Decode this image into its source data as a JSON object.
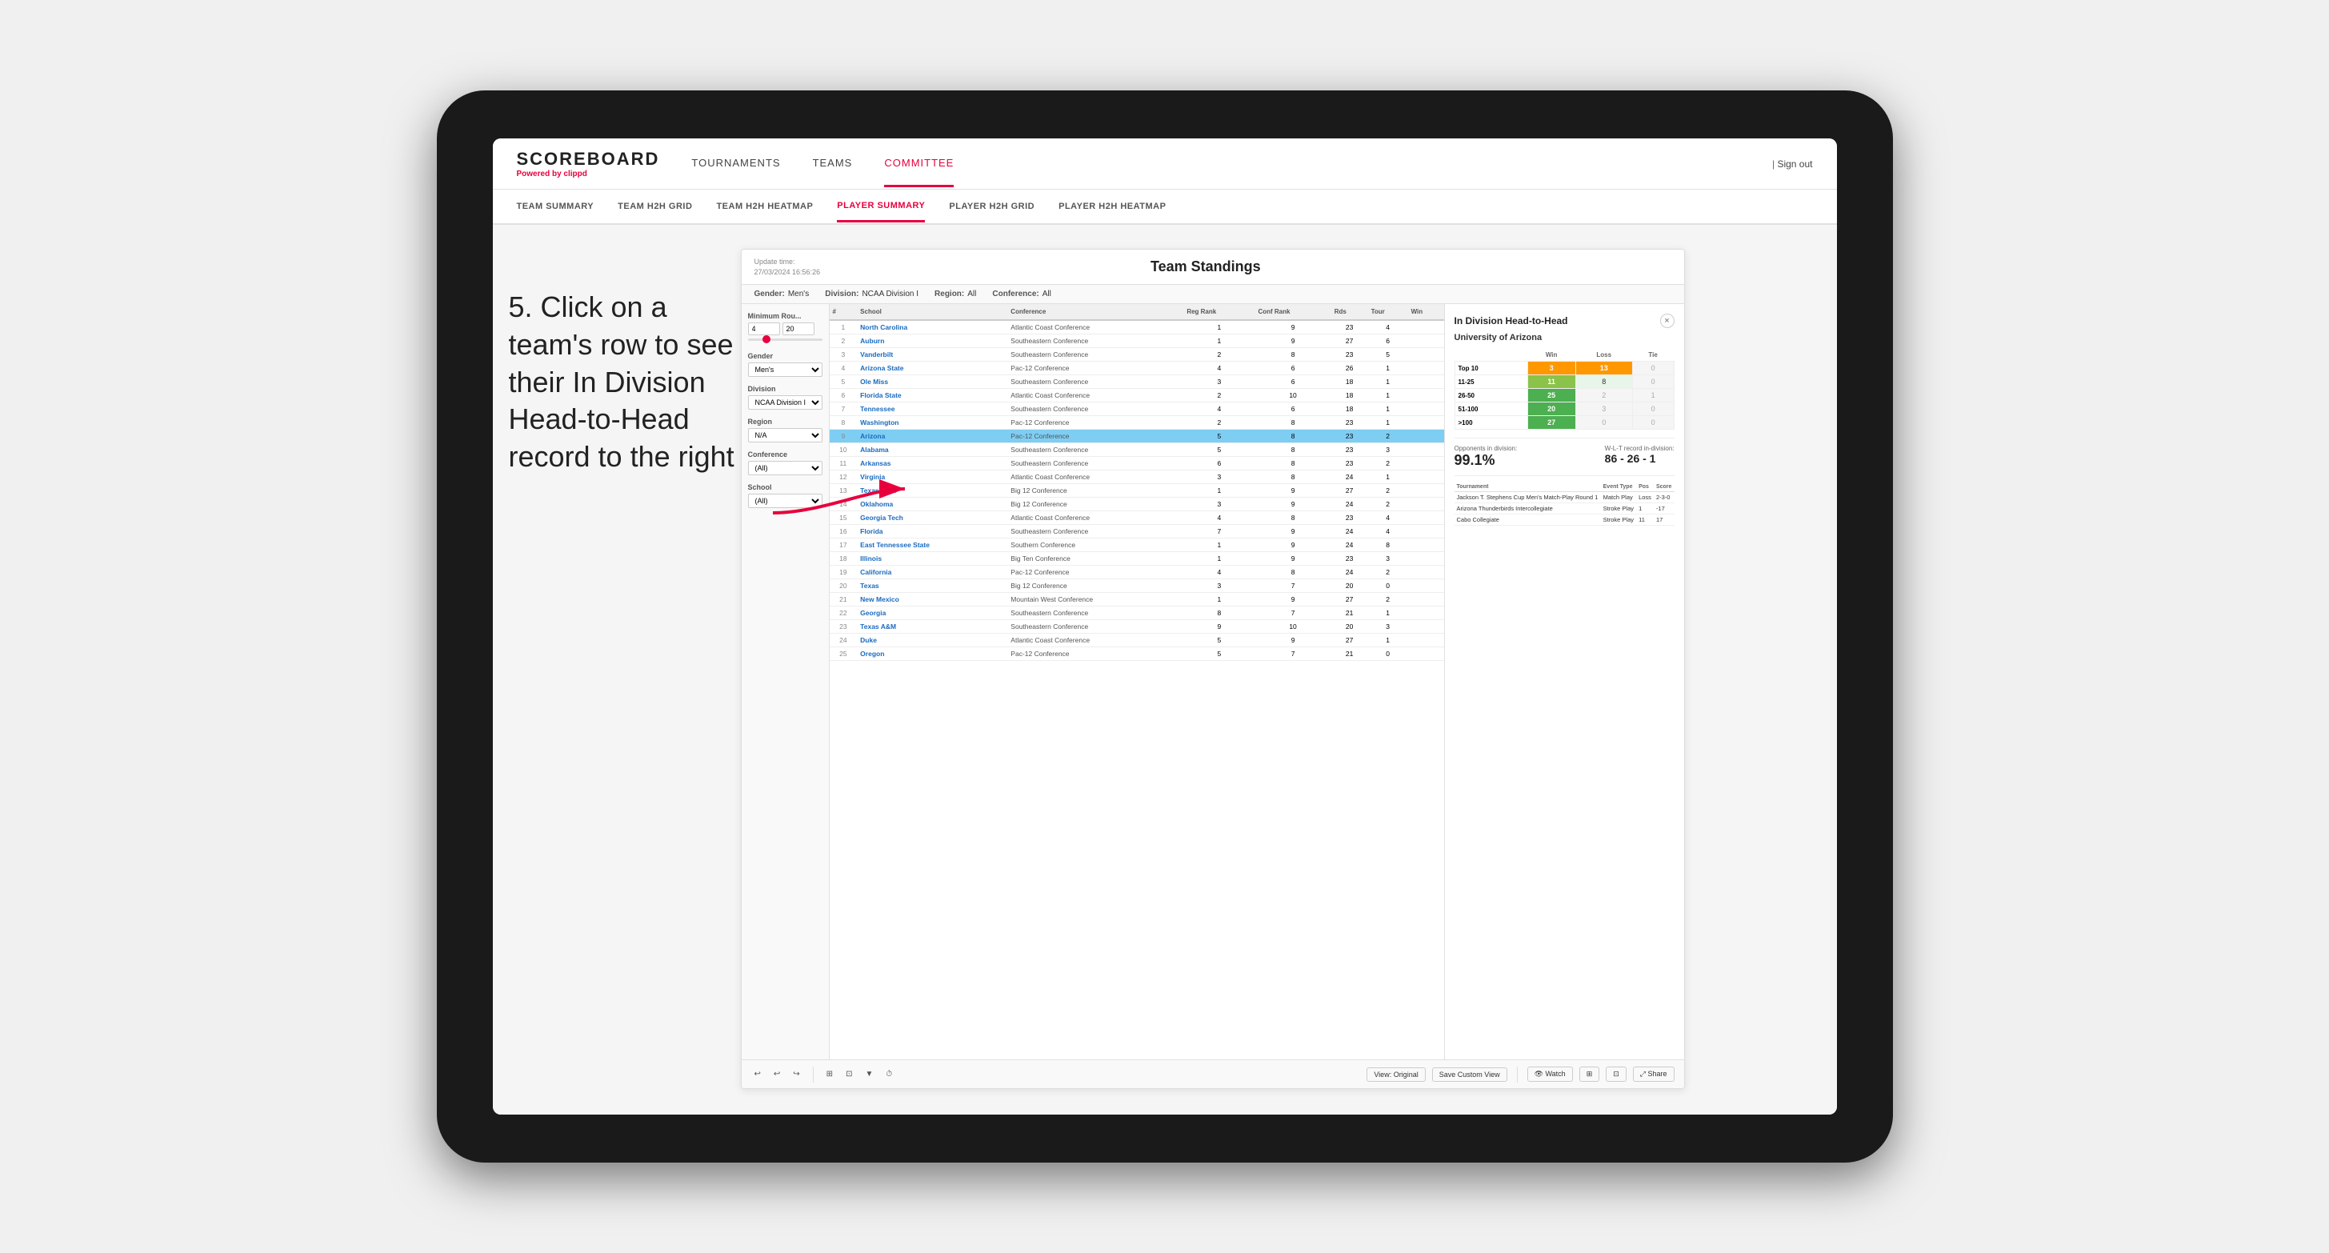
{
  "app": {
    "logo": "SCOREBOARD",
    "logo_sub": "Powered by",
    "logo_brand": "clippd",
    "nav_items": [
      "TOURNAMENTS",
      "TEAMS",
      "COMMITTEE"
    ],
    "active_nav": "COMMITTEE",
    "sign_out": "Sign out"
  },
  "sub_nav": {
    "items": [
      "TEAM SUMMARY",
      "TEAM H2H GRID",
      "TEAM H2H HEATMAP",
      "PLAYER SUMMARY",
      "PLAYER H2H GRID",
      "PLAYER H2H HEATMAP"
    ],
    "active": "PLAYER SUMMARY"
  },
  "panel": {
    "update_time_label": "Update time:",
    "update_time": "27/03/2024 16:56:26",
    "title": "Team Standings",
    "filters": {
      "gender_label": "Gender:",
      "gender": "Men's",
      "division_label": "Division:",
      "division": "NCAA Division I",
      "region_label": "Region:",
      "region": "All",
      "conference_label": "Conference:",
      "conference": "All"
    }
  },
  "sidebar": {
    "min_rounds_label": "Minimum Rou...",
    "min_val": "4",
    "max_val": "20",
    "gender_label": "Gender",
    "gender_value": "Men's",
    "division_label": "Division",
    "division_value": "NCAA Division I",
    "region_label": "Region",
    "region_value": "N/A",
    "conference_label": "Conference",
    "conference_value": "(All)",
    "school_label": "School",
    "school_value": "(All)"
  },
  "table": {
    "headers": [
      "#",
      "School",
      "Conference",
      "Reg Rank",
      "Conf Rank",
      "Rds",
      "Tour",
      "Win"
    ],
    "rows": [
      {
        "rank": 1,
        "school": "North Carolina",
        "conf": "Atlantic Coast Conference",
        "reg_rank": 1,
        "conf_rank": 9,
        "rds": 23,
        "tour": 4,
        "win": ""
      },
      {
        "rank": 2,
        "school": "Auburn",
        "conf": "Southeastern Conference",
        "reg_rank": 1,
        "conf_rank": 9,
        "rds": 27,
        "tour": 6,
        "win": ""
      },
      {
        "rank": 3,
        "school": "Vanderbilt",
        "conf": "Southeastern Conference",
        "reg_rank": 2,
        "conf_rank": 8,
        "rds": 23,
        "tour": 5,
        "win": ""
      },
      {
        "rank": 4,
        "school": "Arizona State",
        "conf": "Pac-12 Conference",
        "reg_rank": 4,
        "conf_rank": 6,
        "rds": 26,
        "tour": 1,
        "win": ""
      },
      {
        "rank": 5,
        "school": "Ole Miss",
        "conf": "Southeastern Conference",
        "reg_rank": 3,
        "conf_rank": 6,
        "rds": 18,
        "tour": 1,
        "win": ""
      },
      {
        "rank": 6,
        "school": "Florida State",
        "conf": "Atlantic Coast Conference",
        "reg_rank": 2,
        "conf_rank": 10,
        "rds": 18,
        "tour": 1,
        "win": ""
      },
      {
        "rank": 7,
        "school": "Tennessee",
        "conf": "Southeastern Conference",
        "reg_rank": 4,
        "conf_rank": 6,
        "rds": 18,
        "tour": 1,
        "win": ""
      },
      {
        "rank": 8,
        "school": "Washington",
        "conf": "Pac-12 Conference",
        "reg_rank": 2,
        "conf_rank": 8,
        "rds": 23,
        "tour": 1,
        "win": ""
      },
      {
        "rank": 9,
        "school": "Arizona",
        "conf": "Pac-12 Conference",
        "reg_rank": 5,
        "conf_rank": 8,
        "rds": 23,
        "tour": 2,
        "win": "",
        "highlight": true
      },
      {
        "rank": 10,
        "school": "Alabama",
        "conf": "Southeastern Conference",
        "reg_rank": 5,
        "conf_rank": 8,
        "rds": 23,
        "tour": 3,
        "win": ""
      },
      {
        "rank": 11,
        "school": "Arkansas",
        "conf": "Southeastern Conference",
        "reg_rank": 6,
        "conf_rank": 8,
        "rds": 23,
        "tour": 2,
        "win": ""
      },
      {
        "rank": 12,
        "school": "Virginia",
        "conf": "Atlantic Coast Conference",
        "reg_rank": 3,
        "conf_rank": 8,
        "rds": 24,
        "tour": 1,
        "win": ""
      },
      {
        "rank": 13,
        "school": "Texas Tech",
        "conf": "Big 12 Conference",
        "reg_rank": 1,
        "conf_rank": 9,
        "rds": 27,
        "tour": 2,
        "win": ""
      },
      {
        "rank": 14,
        "school": "Oklahoma",
        "conf": "Big 12 Conference",
        "reg_rank": 3,
        "conf_rank": 9,
        "rds": 24,
        "tour": 2,
        "win": ""
      },
      {
        "rank": 15,
        "school": "Georgia Tech",
        "conf": "Atlantic Coast Conference",
        "reg_rank": 4,
        "conf_rank": 8,
        "rds": 23,
        "tour": 4,
        "win": ""
      },
      {
        "rank": 16,
        "school": "Florida",
        "conf": "Southeastern Conference",
        "reg_rank": 7,
        "conf_rank": 9,
        "rds": 24,
        "tour": 4,
        "win": ""
      },
      {
        "rank": 17,
        "school": "East Tennessee State",
        "conf": "Southern Conference",
        "reg_rank": 1,
        "conf_rank": 9,
        "rds": 24,
        "tour": 8,
        "win": ""
      },
      {
        "rank": 18,
        "school": "Illinois",
        "conf": "Big Ten Conference",
        "reg_rank": 1,
        "conf_rank": 9,
        "rds": 23,
        "tour": 3,
        "win": ""
      },
      {
        "rank": 19,
        "school": "California",
        "conf": "Pac-12 Conference",
        "reg_rank": 4,
        "conf_rank": 8,
        "rds": 24,
        "tour": 2,
        "win": ""
      },
      {
        "rank": 20,
        "school": "Texas",
        "conf": "Big 12 Conference",
        "reg_rank": 3,
        "conf_rank": 7,
        "rds": 20,
        "tour": 0,
        "win": ""
      },
      {
        "rank": 21,
        "school": "New Mexico",
        "conf": "Mountain West Conference",
        "reg_rank": 1,
        "conf_rank": 9,
        "rds": 27,
        "tour": 2,
        "win": ""
      },
      {
        "rank": 22,
        "school": "Georgia",
        "conf": "Southeastern Conference",
        "reg_rank": 8,
        "conf_rank": 7,
        "rds": 21,
        "tour": 1,
        "win": ""
      },
      {
        "rank": 23,
        "school": "Texas A&M",
        "conf": "Southeastern Conference",
        "reg_rank": 9,
        "conf_rank": 10,
        "rds": 20,
        "tour": 3,
        "win": ""
      },
      {
        "rank": 24,
        "school": "Duke",
        "conf": "Atlantic Coast Conference",
        "reg_rank": 5,
        "conf_rank": 9,
        "rds": 27,
        "tour": 1,
        "win": ""
      },
      {
        "rank": 25,
        "school": "Oregon",
        "conf": "Pac-12 Conference",
        "reg_rank": 5,
        "conf_rank": 7,
        "rds": 21,
        "tour": 0,
        "win": ""
      }
    ]
  },
  "h2h": {
    "title": "In Division Head-to-Head",
    "team": "University of Arizona",
    "close_label": "×",
    "headers": [
      "",
      "Win",
      "Loss",
      "Tie"
    ],
    "rows": [
      {
        "label": "Top 10",
        "win": 3,
        "loss": 13,
        "tie": 0,
        "win_class": "cell-orange",
        "loss_class": "cell-orange"
      },
      {
        "label": "11-25",
        "win": 11,
        "loss": 8,
        "tie": 0,
        "win_class": "cell-light-green",
        "loss_class": "cell-light"
      },
      {
        "label": "26-50",
        "win": 25,
        "loss": 2,
        "tie": 1,
        "win_class": "cell-green",
        "loss_class": "cell-zero"
      },
      {
        "label": "51-100",
        "win": 20,
        "loss": 3,
        "tie": 0,
        "win_class": "cell-green",
        "loss_class": "cell-zero"
      },
      {
        "label": ">100",
        "win": 27,
        "loss": 0,
        "tie": 0,
        "win_class": "cell-green",
        "loss_class": "cell-zero"
      }
    ],
    "opponents_label": "Opponents in division:",
    "opponents_pct": "99.1%",
    "wlt_label": "W-L-T record in-division:",
    "wlt_record": "86 - 26 - 1",
    "tournament_label": "Tournament",
    "event_type_label": "Event Type",
    "pos_label": "Pos",
    "score_label": "Score",
    "tournaments": [
      {
        "name": "Jackson T. Stephens Cup Men's Match-Play Round 1",
        "type": "Match Play",
        "result": "Loss",
        "pos": "2-3-0",
        "score": ""
      },
      {
        "name": "Arizona Thunderbirds Intercollegiate",
        "type": "Stroke Play",
        "pos": "1",
        "score": "-17"
      },
      {
        "name": "Cabo Collegiate",
        "type": "Stroke Play",
        "pos": "11",
        "score": "17"
      }
    ]
  },
  "toolbar": {
    "undo": "↩",
    "redo_back": "↩",
    "redo_fwd": "↪",
    "copy": "⊞",
    "paste": "⊡",
    "clock": "⏱",
    "view_original": "View: Original",
    "save_custom": "Save Custom View",
    "watch": "👁 Watch",
    "share": "⤢ Share"
  },
  "annotation": {
    "text": "5. Click on a team's row to see their In Division Head-to-Head record to the right"
  }
}
